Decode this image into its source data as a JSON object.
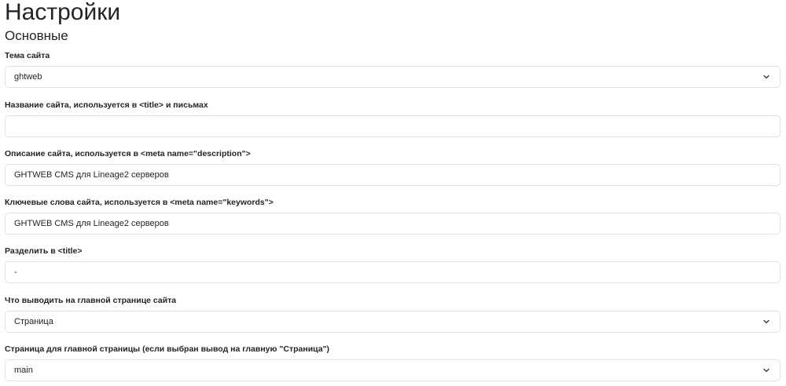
{
  "page": {
    "title": "Настройки",
    "section_title": "Основные"
  },
  "fields": {
    "theme": {
      "label": "Тема сайта",
      "value": "ghtweb"
    },
    "site_name": {
      "label": "Название сайта, используется в <title> и письмах",
      "value": ""
    },
    "description": {
      "label": "Описание сайта, используется в <meta name=\"description\">",
      "value": "GHTWEB CMS для Lineage2 серверов"
    },
    "keywords": {
      "label": "Ключевые слова сайта, используется в <meta name=\"keywords\">",
      "value": "GHTWEB CMS для Lineage2 серверов"
    },
    "title_separator": {
      "label": "Разделить в <title>",
      "value": "-"
    },
    "home_output": {
      "label": "Что выводить на главной странице сайта",
      "value": "Страница"
    },
    "home_page": {
      "label": "Страница для главной страницы (если выбран вывод на главную \"Страница\")",
      "value": "main"
    }
  },
  "icons": {
    "select_arrow": "chevron-down-icon"
  },
  "colors": {
    "border": "#dee2e6",
    "text": "#212529",
    "background": "#ffffff"
  }
}
